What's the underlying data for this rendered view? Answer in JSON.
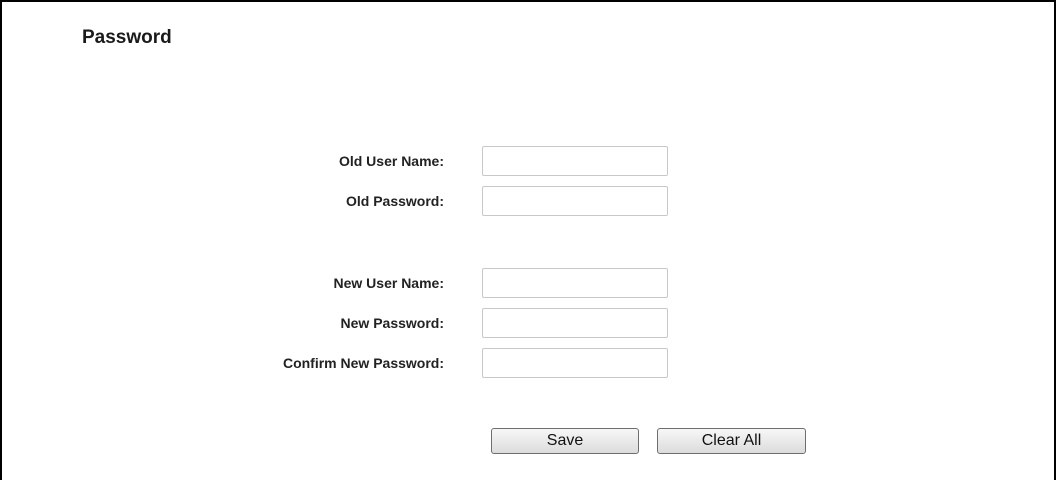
{
  "page": {
    "title": "Password"
  },
  "form": {
    "old_user_name": {
      "label": "Old User Name:",
      "value": ""
    },
    "old_password": {
      "label": "Old Password:",
      "value": ""
    },
    "new_user_name": {
      "label": "New User Name:",
      "value": ""
    },
    "new_password": {
      "label": "New Password:",
      "value": ""
    },
    "confirm_new_password": {
      "label": "Confirm New Password:",
      "value": ""
    }
  },
  "buttons": {
    "save_label": "Save",
    "clear_all_label": "Clear All"
  }
}
